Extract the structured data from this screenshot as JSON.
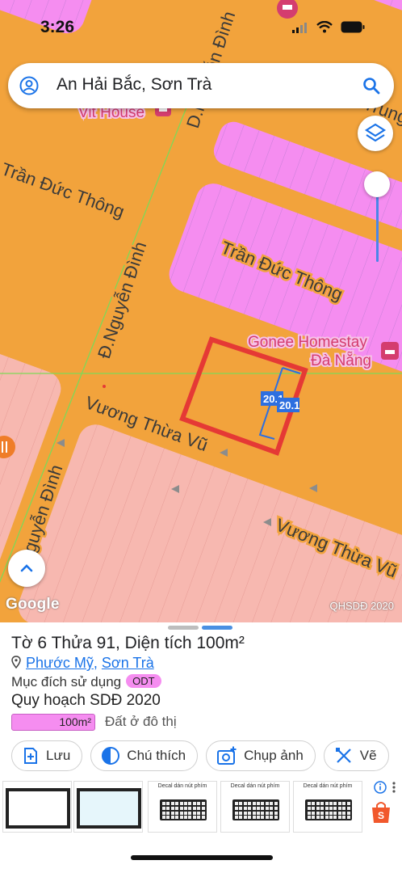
{
  "status_bar": {
    "time": "3:26"
  },
  "search": {
    "query": "An Hải Bắc, Sơn Trà"
  },
  "map": {
    "streets": [
      "Trần Đức Thông",
      "Trần Đức Thông",
      "Đ.Nguyễn Đình",
      "Vương Thừa Vũ",
      "Vương Thừa Vũ",
      "Nguyễn Đình",
      "D.Nguyễn Đình",
      "Lạc Trung"
    ],
    "pois": [
      "Vit House",
      "Gonee Homestay",
      "Đà Nẵng"
    ],
    "measure_labels": [
      "20.1",
      "20.1"
    ],
    "logo": "Google",
    "attribution": "QHSDĐ 2020",
    "colors": {
      "road": "#f2a33c",
      "residential": "#f58df0",
      "planned": "#f7b8b0",
      "selection": "#e53935",
      "measure": "#2d6fe0"
    }
  },
  "sheet": {
    "title": "Tờ 6 Thửa 91, Diện tích 100m²",
    "ward": "Phước Mỹ",
    "district": "Sơn Trà",
    "purpose_label": "Mục đích sử dụng",
    "purpose_code": "ODT",
    "plan_title": "Quy hoạch SDĐ 2020",
    "area_value": "100m²",
    "area_label": "Đất ở đô thị",
    "actions": [
      {
        "label": "Lưu",
        "icon": "add-bookmark-icon"
      },
      {
        "label": "Chú thích",
        "icon": "contrast-icon"
      },
      {
        "label": "Chụp ảnh",
        "icon": "add-photo-icon"
      },
      {
        "label": "Vẽ",
        "icon": "draw-icon"
      }
    ],
    "ads": [
      {
        "caption": ""
      },
      {
        "caption": ""
      },
      {
        "caption": "Decal dán nút phím"
      },
      {
        "caption": "Decal dán nút phím"
      },
      {
        "caption": "Decal dán nút phím"
      }
    ]
  }
}
